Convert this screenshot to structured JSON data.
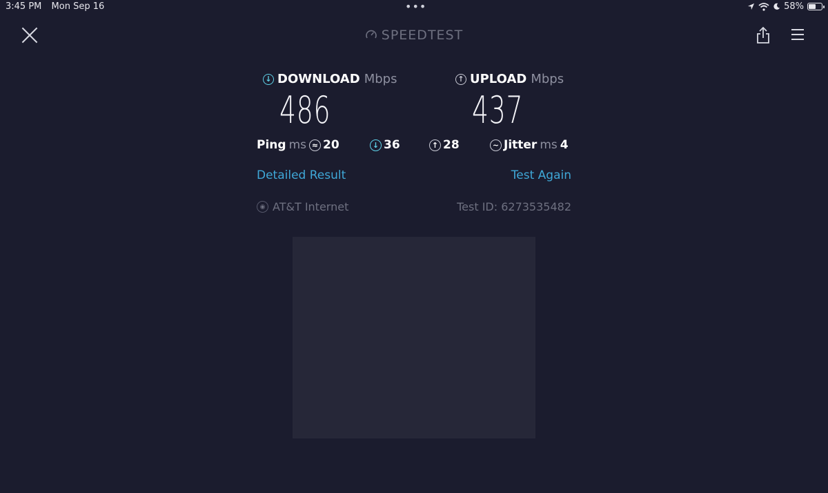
{
  "status_bar": {
    "time": "3:45 PM",
    "date": "Mon Sep 16",
    "multitask_dots": "•••",
    "battery": "58%",
    "battery_level": 0.58
  },
  "header": {
    "title": "SPEEDTEST"
  },
  "download": {
    "label": "DOWNLOAD",
    "unit": "Mbps",
    "value": "486"
  },
  "upload": {
    "label": "UPLOAD",
    "unit": "Mbps",
    "value": "437"
  },
  "ping": {
    "label": "Ping",
    "unit": "ms",
    "idle": "20",
    "download": "36",
    "upload": "28"
  },
  "jitter": {
    "label": "Jitter",
    "unit": "ms",
    "value": "4"
  },
  "links": {
    "detailed_result": "Detailed Result",
    "test_again": "Test Again"
  },
  "provider": {
    "isp": "AT&T Internet",
    "test_id": "Test ID: 6273535482"
  },
  "colors": {
    "background": "#1b1c2e",
    "accent_link": "#3fa8d8",
    "download_accent": "#5fd2e8",
    "muted_text": "#6e7080",
    "ad_placeholder": "#262738"
  }
}
